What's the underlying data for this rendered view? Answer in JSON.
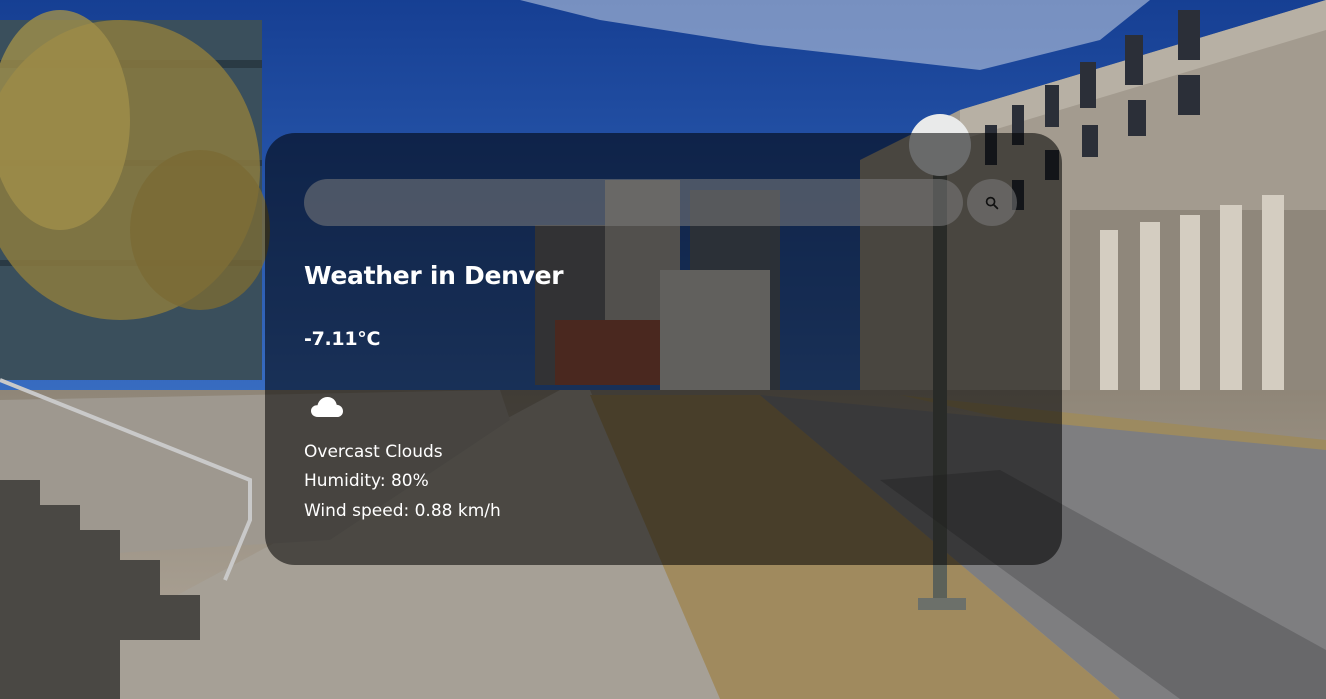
{
  "search": {
    "placeholder": "",
    "button_icon": "search-icon"
  },
  "weather": {
    "title": "Weather in Denver",
    "temperature": "-7.11°C",
    "icon": "cloud-icon",
    "description": "Overcast Clouds",
    "humidity": "Humidity: 80%",
    "wind": "Wind speed: 0.88 km/h"
  },
  "colors": {
    "card_background": "rgba(0,0,0,0.55)",
    "text": "#ffffff",
    "sky": "#1f4fa8"
  }
}
